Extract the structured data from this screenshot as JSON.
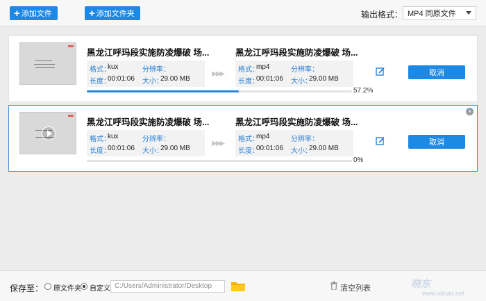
{
  "toolbar": {
    "add_file": "添加文件",
    "add_folder": "添加文件夹",
    "output_format_label": "输出格式：",
    "output_format_value": "MP4  同原文件"
  },
  "items": [
    {
      "src_title": "黑龙江呼玛段实施防凌爆破 场...",
      "src_format_label": "格式：",
      "src_format": "kux",
      "src_resolution_label": "分辨率：",
      "src_resolution": "",
      "src_duration_label": "长度：",
      "src_duration": "00:01:06",
      "src_size_label": "大小：",
      "src_size": "29.00 MB",
      "dst_title": "黑龙江呼玛段实施防凌爆破 场...",
      "dst_format_label": "格式：",
      "dst_format": "mp4",
      "dst_resolution_label": "分辨率：",
      "dst_resolution": "",
      "dst_duration_label": "长度：",
      "dst_duration": "00:01:06",
      "dst_size_label": "大小：",
      "dst_size": "29.00 MB",
      "cancel": "取消",
      "progress_text": "57.2%",
      "progress": 0.572
    },
    {
      "src_title": "黑龙江呼玛段实施防凌爆破 场...",
      "src_format_label": "格式：",
      "src_format": "kux",
      "src_resolution_label": "分辨率：",
      "src_resolution": "",
      "src_duration_label": "长度：",
      "src_duration": "00:01:06",
      "src_size_label": "大小：",
      "src_size": "29.00 MB",
      "dst_title": "黑龙江呼玛段实施防凌爆破 场...",
      "dst_format_label": "格式：",
      "dst_format": "mp4",
      "dst_resolution_label": "分辨率：",
      "dst_resolution": "",
      "dst_duration_label": "长度：",
      "dst_duration": "00:01:06",
      "dst_size_label": "大小：",
      "dst_size": "29.00 MB",
      "cancel": "取消",
      "progress_text": "0%",
      "progress": 0.0
    }
  ],
  "bottom": {
    "save_to": "保存至：",
    "original_folder": "原文件夹",
    "custom": "自定义",
    "path": "C:/Users/Administrator/Desktop",
    "clear_list": "清空列表",
    "watermark": "晓东",
    "watermark_url": "www.xdcad.net"
  },
  "colors": {
    "accent": "#1e88e5",
    "selected_border": "#3f90df",
    "label_blue": "#2a7fd4"
  }
}
